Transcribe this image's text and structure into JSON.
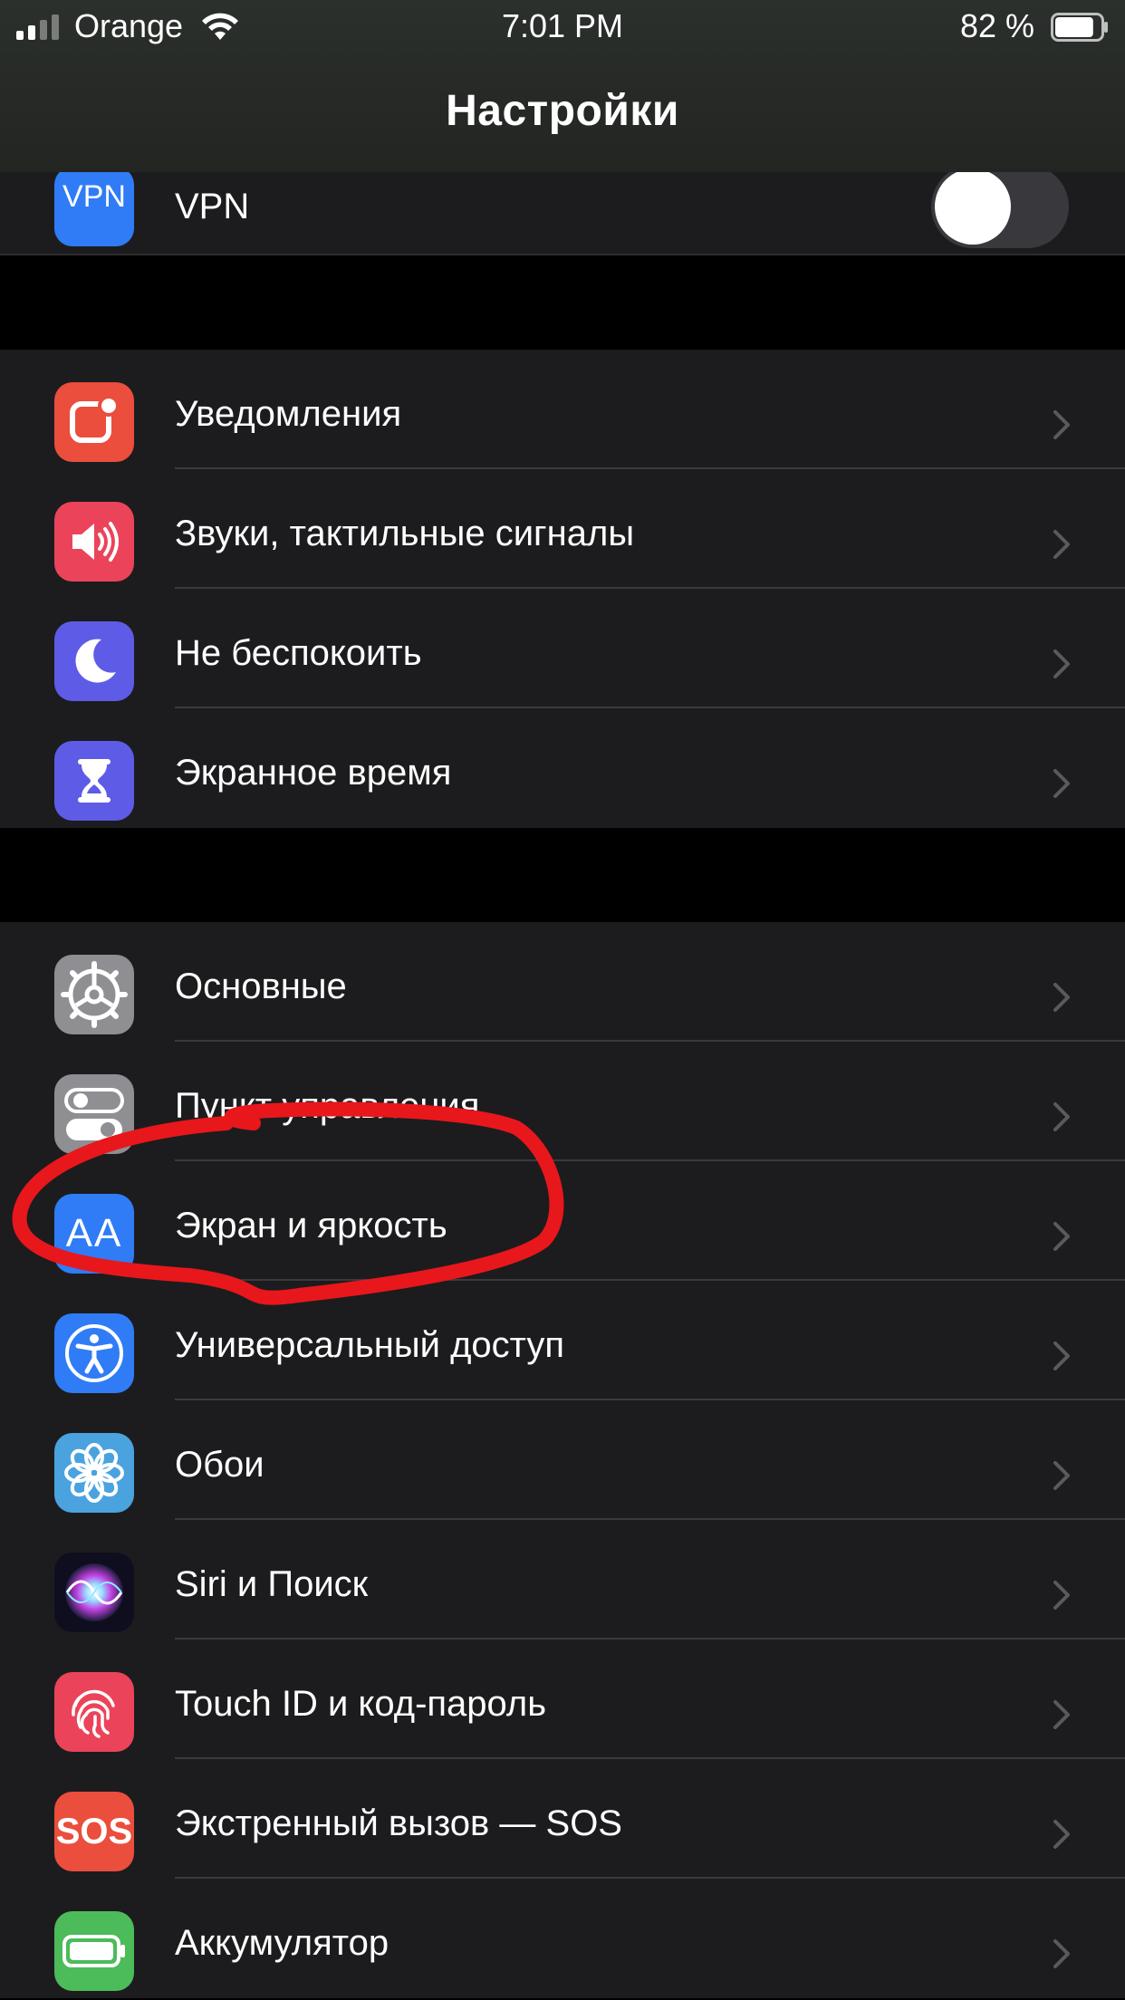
{
  "status_bar": {
    "carrier": "Orange",
    "time": "7:01 PM",
    "battery_percent": "82 %",
    "battery_level": 0.82,
    "signal_bars": 2
  },
  "header": {
    "title": "Настройки"
  },
  "vpn": {
    "icon_text": "VPN",
    "label": "VPN",
    "toggle_on": false
  },
  "group1": [
    {
      "label": "Уведомления",
      "icon": "notifications-icon",
      "color": "#eb4e3d"
    },
    {
      "label": "Звуки, тактильные сигналы",
      "icon": "speaker-icon",
      "color": "#eb445a"
    },
    {
      "label": "Не беспокоить",
      "icon": "moon-icon",
      "color": "#5e5ce6"
    },
    {
      "label": "Экранное время",
      "icon": "hourglass-icon",
      "color": "#5e5ce6"
    }
  ],
  "group2": [
    {
      "label": "Основные",
      "icon": "gear-icon",
      "color": "#8e8e93"
    },
    {
      "label": "Пункт управления",
      "icon": "toggles-icon",
      "color": "#8e8e93"
    },
    {
      "label": "Экран и яркость",
      "icon": "text-size-icon",
      "icon_text": "AA",
      "color": "#2f7cf6"
    },
    {
      "label": "Универсальный доступ",
      "icon": "accessibility-icon",
      "color": "#2f7cf6"
    },
    {
      "label": "Обои",
      "icon": "flower-icon",
      "color": "#4aa3df"
    },
    {
      "label": "Siri и Поиск",
      "icon": "siri-icon",
      "color": "#1c1c3a"
    },
    {
      "label": "Touch ID и код-пароль",
      "icon": "fingerprint-icon",
      "color": "#eb445a"
    },
    {
      "label": "Экстренный вызов — SOS",
      "icon": "sos-icon",
      "icon_text": "SOS",
      "color": "#eb4e3d"
    },
    {
      "label": "Аккумулятор",
      "icon": "battery-icon",
      "color": "#4cbb5a"
    }
  ],
  "annotation": {
    "color": "#e8171c"
  }
}
